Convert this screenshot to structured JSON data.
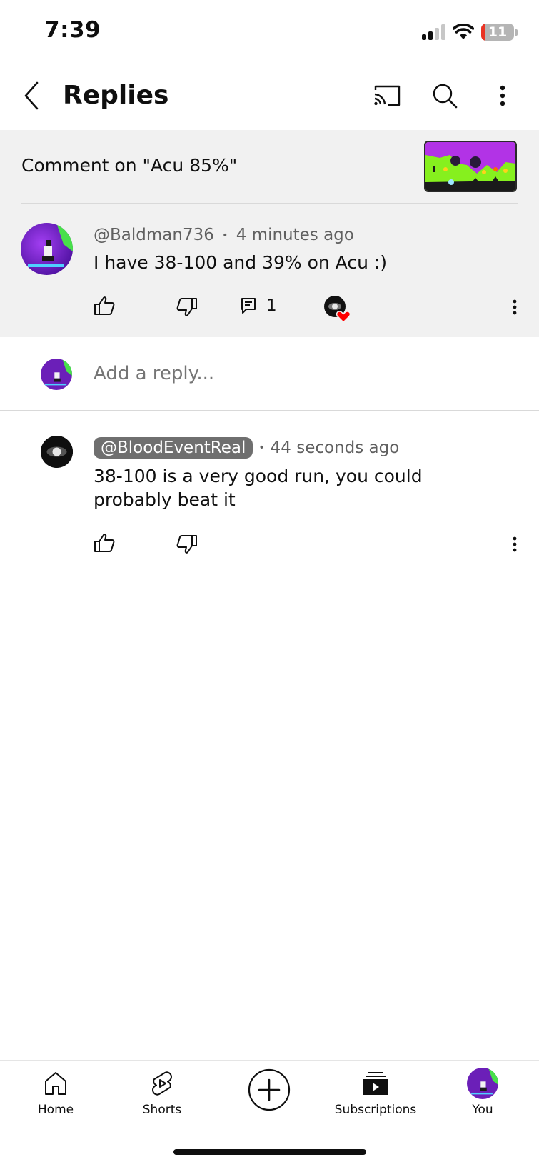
{
  "status_bar": {
    "time": "7:39",
    "battery_level": "11",
    "icons": [
      "signal-icon",
      "wifi-icon",
      "battery-icon"
    ]
  },
  "header": {
    "title": "Replies",
    "icons": [
      "back-icon",
      "cast-icon",
      "search-icon",
      "more-vert-icon"
    ]
  },
  "context": {
    "label": "Comment on \"Acu 85%\""
  },
  "parent_comment": {
    "author": "@Baldman736",
    "separator": "•",
    "time": "4 minutes ago",
    "text": "I have 38-100 and 39% on Acu :)",
    "reply_count": "1",
    "creator_hearted": true
  },
  "composer": {
    "placeholder": "Add a reply..."
  },
  "reply": {
    "author": "@BloodEventReal",
    "separator": "•",
    "time": "44 seconds ago",
    "text": "38-100 is a very good run, you could probably beat it"
  },
  "bottom_nav": {
    "home": "Home",
    "shorts": "Shorts",
    "subscriptions": "Subscriptions",
    "you": "You"
  },
  "colors": {
    "panel_bg": "#f1f1f1",
    "text_primary": "#0f0f0f",
    "text_secondary": "#606060",
    "author_badge_bg": "#6f6f6f",
    "heart": "#ff0000",
    "avatar_purple": "#6b1fb8"
  }
}
